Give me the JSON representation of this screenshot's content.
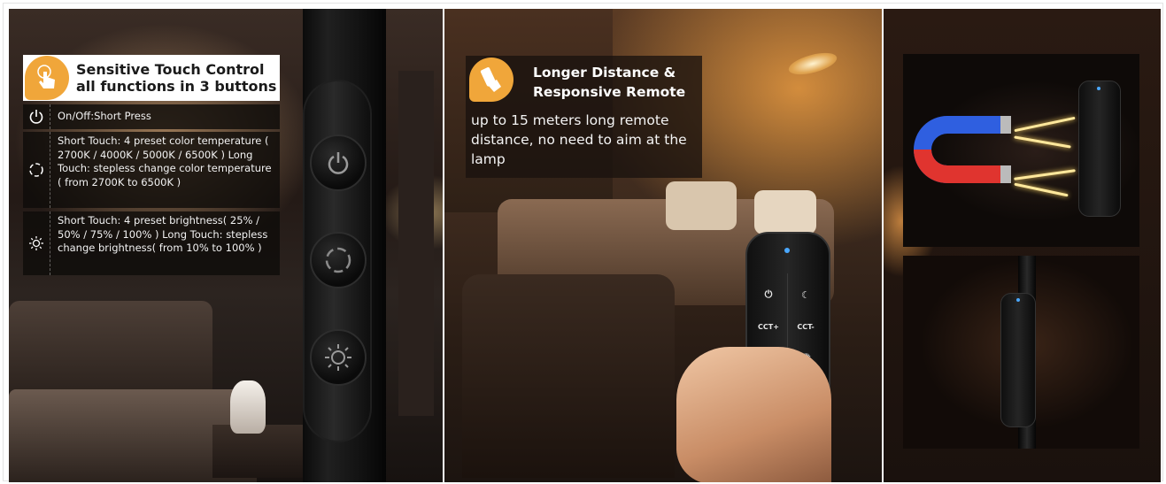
{
  "panel1": {
    "title_line1": "Sensitive Touch Control",
    "title_line2": "all functions in 3 buttons",
    "rows": [
      {
        "icon": "power-icon",
        "text": "On/Off:Short Press"
      },
      {
        "icon": "color-temperature-icon",
        "text": "Short Touch: 4 preset color temperature ( 2700K / 4000K / 5000K / 6500K ) Long Touch: stepless change color temperature ( from 2700K to 6500K )"
      },
      {
        "icon": "brightness-icon",
        "text": "Short Touch: 4 preset brightness( 25% / 50% / 75% / 100% ) Long Touch: stepless change brightness( from 10% to 100% )"
      }
    ]
  },
  "panel2": {
    "title_line1": "Longer Distance &",
    "title_line2": "Responsive Remote",
    "description": "up to 15 meters long remote distance, no need to aim at the lamp",
    "remote_buttons": {
      "power": "⏻",
      "night": "☾",
      "cct_up": "CCT+",
      "cct_down": "CCT-",
      "bright_down": "☼",
      "bright_up": "✺"
    }
  },
  "colors": {
    "accent_orange": "#f0a63a",
    "overlay_dark": "#0f0c0a",
    "magnet_red": "#e0342f",
    "magnet_blue": "#2f5fe0",
    "lightning": "#ffe89c"
  }
}
